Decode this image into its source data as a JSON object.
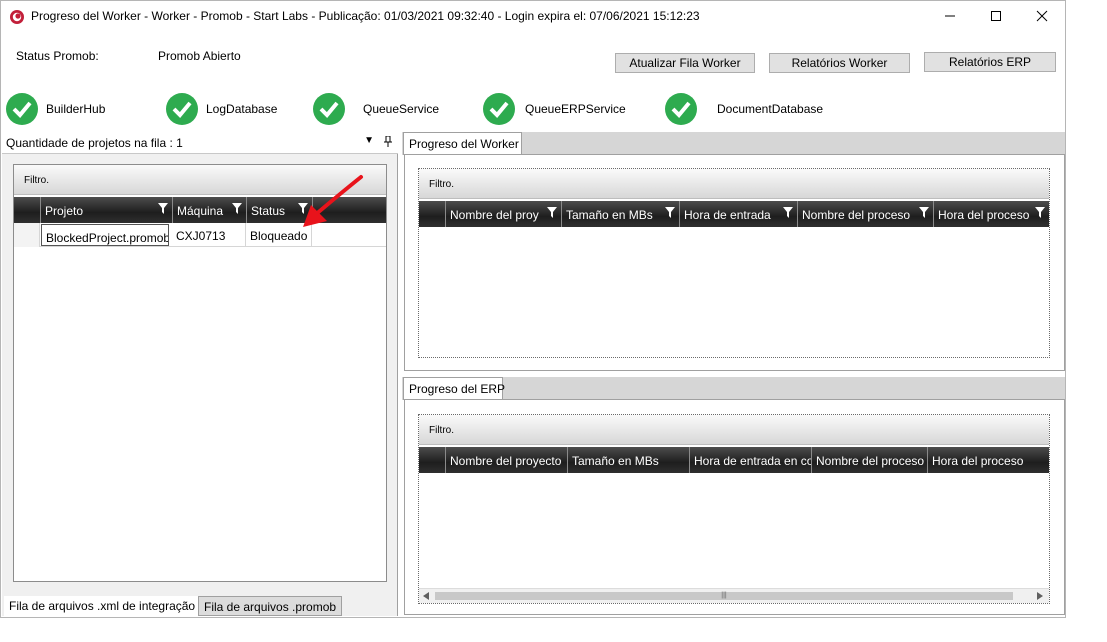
{
  "window": {
    "title": "Progreso del Worker  -  Worker - Promob  -  Start Labs  -  Publicação: 01/03/2021 09:32:40 - Login expira el: 07/06/2021 15:12:23",
    "controls": {
      "minimize": "—",
      "maximize": "☐",
      "close": "✕"
    }
  },
  "status": {
    "label": "Status Promob:",
    "value": "Promob Abierto"
  },
  "buttons": {
    "update_queue": "Atualizar Fila Worker",
    "worker_reports": "Relatórios Worker",
    "erp_reports": "Relatórios ERP"
  },
  "services": [
    {
      "name": "BuilderHub",
      "status": "ok"
    },
    {
      "name": "LogDatabase",
      "status": "ok"
    },
    {
      "name": "QueueService",
      "status": "ok"
    },
    {
      "name": "QueueERPService",
      "status": "ok"
    },
    {
      "name": "DocumentDatabase",
      "status": "ok"
    }
  ],
  "colors": {
    "check_green": "#2eab4f",
    "header_dark": "#1e1e1e"
  },
  "left_panel": {
    "title": "Quantidade de projetos na fila : 1",
    "filter": "Filtro.",
    "columns": [
      "Projeto",
      "Máquina",
      "Status"
    ],
    "rows": [
      [
        "BlockedProject.promob",
        "CXJ0713",
        "Bloqueado"
      ]
    ],
    "tabs": [
      "Fila de arquivos .xml de integração",
      "Fila de arquivos .promob"
    ]
  },
  "worker_panel": {
    "tab": "Progreso del Worker",
    "filter": "Filtro.",
    "columns": [
      "Nombre del proy",
      "Tamaño en MBs",
      "Hora de entrada",
      "Nombre del proceso",
      "Hora del proceso"
    ]
  },
  "erp_panel": {
    "tab": "Progreso del ERP",
    "filter": "Filtro.",
    "columns": [
      "Nombre del proyecto",
      "Tamaño en MBs",
      "Hora de entrada en co",
      "Nombre del proceso",
      "Hora del proceso"
    ],
    "scroll_grip": "|||"
  }
}
